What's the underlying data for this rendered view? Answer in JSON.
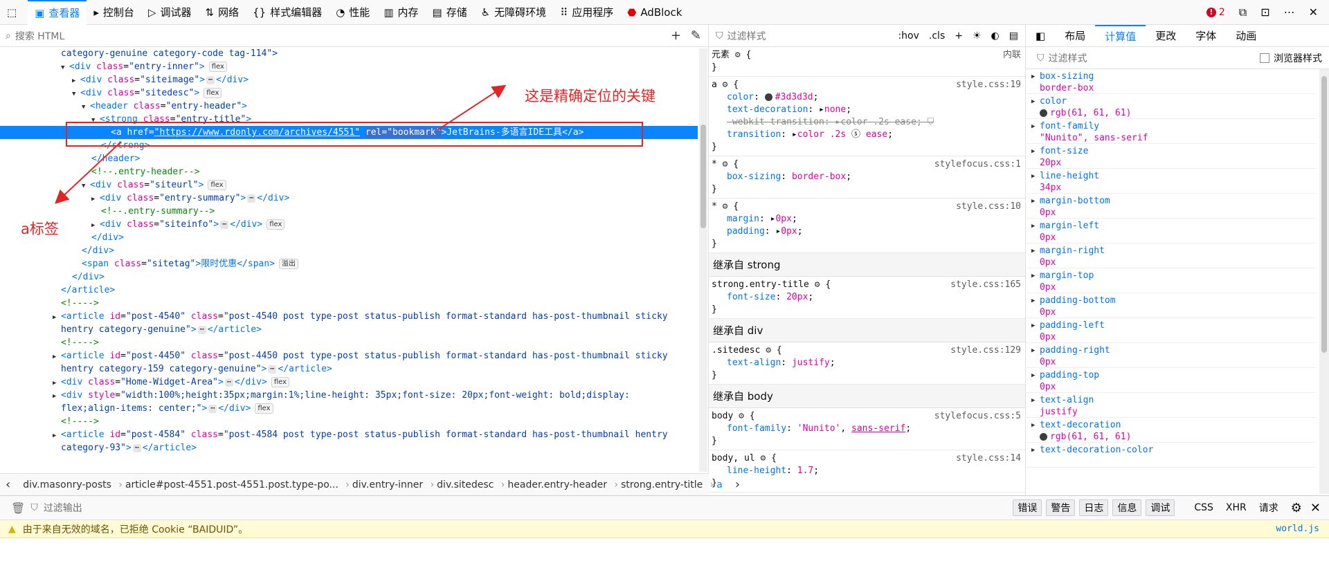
{
  "toolbar": {
    "tabs": [
      {
        "label": "查看器",
        "icon": "inspector-icon"
      },
      {
        "label": "控制台",
        "icon": "console-icon"
      },
      {
        "label": "调试器",
        "icon": "debugger-icon"
      },
      {
        "label": "网络",
        "icon": "network-icon"
      },
      {
        "label": "样式编辑器",
        "icon": "style-editor-icon"
      },
      {
        "label": "性能",
        "icon": "performance-icon"
      },
      {
        "label": "内存",
        "icon": "memory-icon"
      },
      {
        "label": "存储",
        "icon": "storage-icon"
      },
      {
        "label": "无障碍环境",
        "icon": "accessibility-icon"
      },
      {
        "label": "应用程序",
        "icon": "application-icon"
      },
      {
        "label": "AdBlock",
        "icon": "adblock-icon"
      }
    ],
    "error_count": "2"
  },
  "inspector": {
    "search_placeholder": "搜索 HTML",
    "markup": {
      "l1": "category-genuine category-code tag-114\">",
      "l2_tag": "<div ",
      "l2_attr": "class",
      "l2_val": "\"entry-inner\"",
      "l2_end": ">",
      "l2_badge": "flex",
      "l3_tag": "<div ",
      "l3_attr": "class",
      "l3_val": "\"siteimage\"",
      "l3_end": ">",
      "l3_close": "</div>",
      "l4_tag": "<div ",
      "l4_attr": "class",
      "l4_val": "\"sitedesc\"",
      "l4_end": ">",
      "l4_badge": "flex",
      "l5_tag": "<header ",
      "l5_attr": "class",
      "l5_val": "\"entry-header\"",
      "l5_end": ">",
      "l6_tag": "<strong ",
      "l6_attr": "class",
      "l6_val": "\"entry-title\"",
      "l6_end": ">",
      "l7_tag": "<a ",
      "l7_attr1": "href",
      "l7_val1": "\"https://www.rdonly.com/archives/4551\"",
      "l7_attr2": "rel",
      "l7_val2": "\"bookmark\"",
      "l7_text": ">JetBrains-多语言IDE工具</a>",
      "l8": "</strong>",
      "l9": "</header>",
      "l10": "<!--.entry-header-->",
      "l11_tag": "<div ",
      "l11_attr": "class",
      "l11_val": "\"siteurl\"",
      "l11_end": ">",
      "l11_badge": "flex",
      "l12_tag": "<div ",
      "l12_attr": "class",
      "l12_val": "\"entry-summary\"",
      "l12_end": ">",
      "l12_close": "</div>",
      "l13": "<!--.entry-summary-->",
      "l14_tag": "<div ",
      "l14_attr": "class",
      "l14_val": "\"siteinfo\"",
      "l14_end": ">",
      "l14_close": "</div>",
      "l14_badge": "flex",
      "l15": "</div>",
      "l16": "</div>",
      "l17_tag": "<span ",
      "l17_attr": "class",
      "l17_val": "\"sitetag\"",
      "l17_text": ">限时优惠</span>",
      "l17_badge": "溢出",
      "l18": "</div>",
      "l19": "</article>",
      "l20": "<!---->",
      "l21_tag": "<article ",
      "l21_attr1": "id",
      "l21_val1": "\"post-4540\"",
      "l21_attr2": "class",
      "l21_val2": "\"post-4540 post type-post status-publish format-standard has-post-thumbnail sticky",
      "l22_val": "hentry category-genuine\"",
      "l22_end": ">",
      "l22_close": "</article>",
      "l23": "<!---->",
      "l24_tag": "<article ",
      "l24_attr1": "id",
      "l24_val1": "\"post-4450\"",
      "l24_attr2": "class",
      "l24_val2": "\"post-4450 post type-post status-publish format-standard has-post-thumbnail sticky",
      "l25_val": "hentry category-159 category-genuine\"",
      "l25_end": ">",
      "l25_close": "</article>",
      "l26_tag": "<div ",
      "l26_attr": "class",
      "l26_val": "\"Home-Widget-Area\"",
      "l26_end": ">",
      "l26_close": "</div>",
      "l26_badge": "flex",
      "l27_tag": "<div ",
      "l27_attr": "style",
      "l27_val": "\"width:100%;height:35px;margin:1%;line-height: 35px;font-size: 20px;font-weight: bold;display:",
      "l28_val": "flex;align-items: center;\"",
      "l28_end": ">",
      "l28_close": "</div>",
      "l28_badge": "flex",
      "l29": "<!---->",
      "l30_tag": "<article ",
      "l30_attr1": "id",
      "l30_val1": "\"post-4584\"",
      "l30_attr2": "class",
      "l30_val2": "\"post-4584 post type-post status-publish format-standard has-post-thumbnail hentry",
      "l31_val": "category-93\"",
      "l31_end": ">",
      "l31_close": "</article>",
      "ellipsis": "⋯"
    },
    "breadcrumbs": [
      "div.masonry-posts",
      "article#post-4551.post-4551.post.type-po...",
      "div.entry-inner",
      "div.sitedesc",
      "header.entry-header",
      "strong.entry-title",
      "a"
    ]
  },
  "annotations": {
    "key_note": "这是精确定位的关键",
    "a_tag_note": "a标签"
  },
  "rules": {
    "filter_placeholder": "过滤样式",
    "hov": ":hov",
    "cls": ".cls",
    "element_label": "元素",
    "inline_label": "内联",
    "rule_a_selector": "a",
    "rule_a_source": "style.css:19",
    "rule_a_color_prop": "color",
    "rule_a_color_val": "#3d3d3d",
    "rule_a_td_prop": "text-decoration",
    "rule_a_td_val": "none",
    "rule_a_wt_prop": "-webkit-transition",
    "rule_a_wt_val": "color .2s ease",
    "rule_a_tr_prop": "transition",
    "rule_a_tr_val1": "color .2s",
    "rule_a_tr_val2": "ease",
    "rule_star1_source": "stylefocus.css:1",
    "rule_star1_prop": "box-sizing",
    "rule_star1_val": "border-box",
    "rule_star2_source": "style.css:10",
    "rule_star2_p1": "margin",
    "rule_star2_v1": "0px",
    "rule_star2_p2": "padding",
    "rule_star2_v2": "0px",
    "inh_strong": "继承自 strong",
    "rule_strong_selector": "strong.entry-title",
    "rule_strong_source": "style.css:165",
    "rule_strong_prop": "font-size",
    "rule_strong_val": "20px",
    "inh_div": "继承自 div",
    "rule_div_selector": ".sitedesc",
    "rule_div_source": "style.css:129",
    "rule_div_prop": "text-align",
    "rule_div_val": "justify",
    "inh_body": "继承自 body",
    "rule_body_selector": "body",
    "rule_body_source": "stylefocus.css:5",
    "rule_body_prop": "font-family",
    "rule_body_val1": "'Nunito'",
    "rule_body_val2": "sans-serif",
    "rule_bodyul_selector": "body, ul",
    "rule_bodyul_source": "style.css:14",
    "rule_bodyul_prop": "line-height",
    "rule_bodyul_val": "1.7"
  },
  "computed": {
    "tabs": [
      "布局",
      "计算值",
      "更改",
      "字体",
      "动画"
    ],
    "filter_placeholder": "过滤样式",
    "browser_styles_label": "浏览器样式",
    "props": [
      {
        "name": "box-sizing",
        "value": "border-box"
      },
      {
        "name": "color",
        "value": "rgb(61, 61, 61)"
      },
      {
        "name": "font-family",
        "value": "\"Nunito\", sans-serif"
      },
      {
        "name": "font-size",
        "value": "20px"
      },
      {
        "name": "line-height",
        "value": "34px"
      },
      {
        "name": "margin-bottom",
        "value": "0px"
      },
      {
        "name": "margin-left",
        "value": "0px"
      },
      {
        "name": "margin-right",
        "value": "0px"
      },
      {
        "name": "margin-top",
        "value": "0px"
      },
      {
        "name": "padding-bottom",
        "value": "0px"
      },
      {
        "name": "padding-left",
        "value": "0px"
      },
      {
        "name": "padding-right",
        "value": "0px"
      },
      {
        "name": "padding-top",
        "value": "0px"
      },
      {
        "name": "text-align",
        "value": "justify"
      },
      {
        "name": "text-decoration",
        "value": "rgb(61, 61, 61)"
      },
      {
        "name": "text-decoration-color",
        "value": ""
      }
    ]
  },
  "console": {
    "filter_placeholder": "过滤输出",
    "buttons": [
      "错误",
      "警告",
      "日志",
      "信息",
      "调试"
    ],
    "types": [
      "CSS",
      "XHR",
      "请求"
    ],
    "warning_text": "由于来自无效的域名，已拒绝 Cookie “BAIDUID”。",
    "warning_source": "world.js"
  },
  "colors": {
    "accent": "#0a84ff",
    "annotation_red": "#e42424"
  }
}
